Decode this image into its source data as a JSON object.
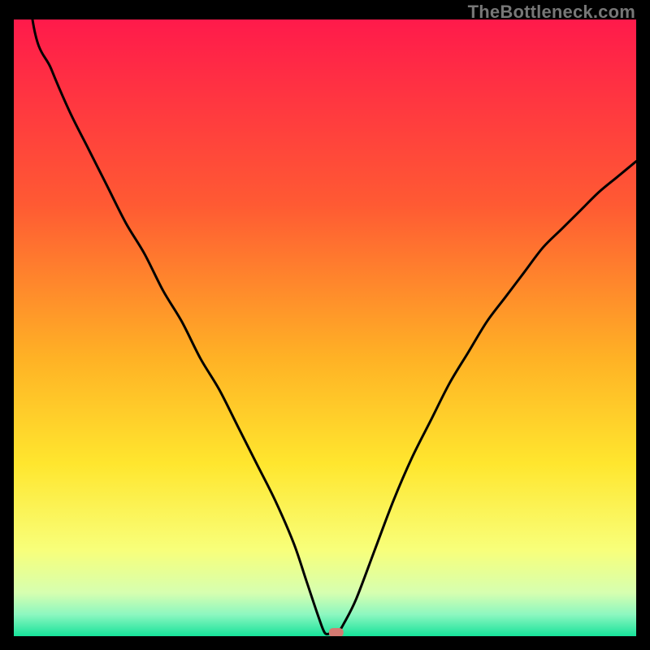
{
  "watermark": "TheBottleneck.com",
  "chart_data": {
    "type": "line",
    "title": "",
    "xlabel": "",
    "ylabel": "",
    "xlim": [
      0,
      100
    ],
    "ylim": [
      0,
      100
    ],
    "series": [
      {
        "name": "curve",
        "x": [
          0,
          3,
          6,
          9,
          12,
          15,
          18,
          21,
          24,
          27,
          30,
          33,
          36,
          39,
          42,
          45,
          47,
          49,
          50,
          51,
          52,
          53,
          55,
          58,
          61,
          64,
          67,
          70,
          73,
          76,
          79,
          82,
          85,
          88,
          91,
          94,
          97,
          100
        ],
        "y": [
          130,
          100,
          92,
          85,
          79,
          73,
          67,
          62,
          56,
          51,
          45,
          40,
          34,
          28,
          22,
          15,
          9,
          3,
          0.5,
          0.5,
          0.5,
          2,
          6,
          14,
          22,
          29,
          35,
          41,
          46,
          51,
          55,
          59,
          63,
          66,
          69,
          72,
          74.5,
          77
        ]
      }
    ],
    "marker": {
      "x": 51.8,
      "y": 0.6,
      "color": "#d47a72"
    },
    "gradient_stops": [
      {
        "offset": 0.0,
        "color": "#ff1a4b"
      },
      {
        "offset": 0.3,
        "color": "#ff5a33"
      },
      {
        "offset": 0.55,
        "color": "#ffb225"
      },
      {
        "offset": 0.72,
        "color": "#ffe62e"
      },
      {
        "offset": 0.86,
        "color": "#f8ff7a"
      },
      {
        "offset": 0.93,
        "color": "#d6ffb0"
      },
      {
        "offset": 0.965,
        "color": "#8cf7c0"
      },
      {
        "offset": 1.0,
        "color": "#17e29a"
      }
    ]
  }
}
